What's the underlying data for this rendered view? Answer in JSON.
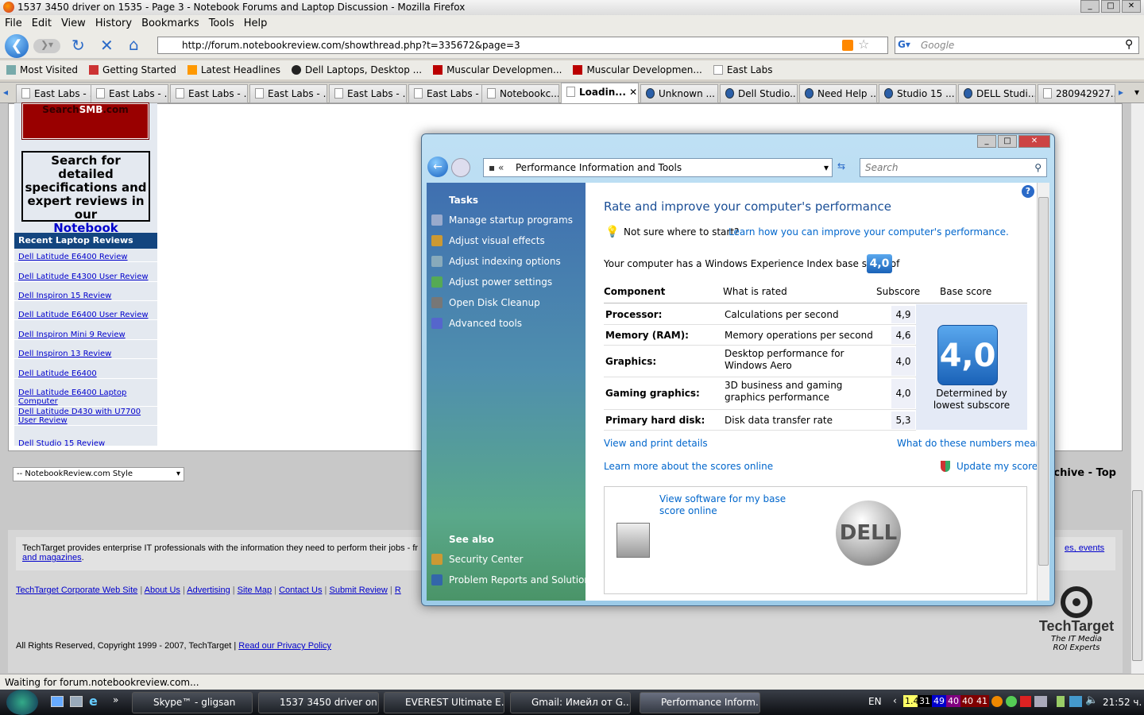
{
  "window": {
    "title": "1537 3450 driver on 1535 - Page 3 - Notebook Forums and Laptop Discussion - Mozilla Firefox"
  },
  "menu": [
    "File",
    "Edit",
    "View",
    "History",
    "Bookmarks",
    "Tools",
    "Help"
  ],
  "nav": {
    "url": "http://forum.notebookreview.com/showthread.php?t=335672&page=3",
    "search_placeholder": "Google"
  },
  "bookmarks": [
    "Most Visited",
    "Getting Started",
    "Latest Headlines",
    "Dell Laptops, Desktop ...",
    "Muscular Developmen...",
    "Muscular Developmen...",
    "East Labs"
  ],
  "tabs": [
    "East Labs - ...",
    "East Labs - ...",
    "East Labs - ...",
    "East Labs - ...",
    "East Labs - ...",
    "East Labs - ...",
    "Notebookc...",
    "Loadin...",
    "Unknown ...",
    "Dell Studio...",
    "Need Help ...",
    "Studio 15 ...",
    "DELL Studi...",
    "280942927..."
  ],
  "page": {
    "smb_a": "Search",
    "smb_b": "SMB",
    ".smb_c": ".com",
    "smb_c": ".com",
    "db_text": "Search for detailed specifications and expert reviews in our",
    "db_link": "Notebook Database",
    "reviews_heading": "Recent Laptop Reviews",
    "reviews": [
      "Dell Latitude E6400 Review",
      "Dell Latitude E4300 User Review",
      "Dell Inspiron 15 Review",
      "Dell Latitude E6400 User Review",
      "Dell Inspiron Mini 9 Review",
      "Dell Inspiron 13 Review",
      "Dell Latitude E6400",
      "Dell Latitude E6400 Laptop Computer",
      "Dell Latitude D430 with U7700 User Review",
      "Dell Studio 15 Review"
    ],
    "style_select": "-- NotebookReview.com Style",
    "archive_top": "rchive - Top",
    "footer_text": "TechTarget provides enterprise IT professionals with the information they need to perform their jobs - fr",
    "footer_link1": "and magazines",
    "footer_link2": "es, events",
    "footer_links": [
      "TechTarget Corporate Web Site",
      "About Us",
      "Advertising",
      "Site Map",
      "Contact Us",
      "Submit Review",
      "R"
    ],
    "copyright": "All Rights Reserved, Copyright 1999 - 2007, TechTarget |",
    "privacy": "Read our Privacy Policy",
    "tt_name": "TechTarget",
    "tt_tag1": "The IT Media",
    "tt_tag2": "ROI Experts"
  },
  "status": "Waiting for forum.notebookreview.com...",
  "perf": {
    "address": "Performance Information and Tools",
    "search_placeholder": "Search",
    "tasks_heading": "Tasks",
    "tasks": [
      "Manage startup programs",
      "Adjust visual effects",
      "Adjust indexing options",
      "Adjust power settings",
      "Open Disk Cleanup",
      "Advanced tools"
    ],
    "see_also": "See also",
    "see_also_items": [
      "Security Center",
      "Problem Reports and Solutions"
    ],
    "title": "Rate and improve your computer's performance",
    "hint": "Not sure where to start?",
    "hint_link": "Learn how you can improve your computer's performance.",
    "base_text": "Your computer has a Windows Experience Index base score of",
    "base_score": "4,0",
    "headers": [
      "Component",
      "What is rated",
      "Subscore",
      "Base score"
    ],
    "rows": [
      {
        "component": "Processor:",
        "rated": "Calculations per second",
        "score": "4,9"
      },
      {
        "component": "Memory (RAM):",
        "rated": "Memory operations per second",
        "score": "4,6"
      },
      {
        "component": "Graphics:",
        "rated": "Desktop performance for Windows Aero",
        "score": "4,0"
      },
      {
        "component": "Gaming graphics:",
        "rated": "3D business and gaming graphics performance",
        "score": "4,0"
      },
      {
        "component": "Primary hard disk:",
        "rated": "Disk data transfer rate",
        "score": "5,3"
      }
    ],
    "determined": "Determined by lowest subscore",
    "view_print": "View and print details",
    "what_mean": "What do these numbers mean?",
    "learn_more": "Learn more about the scores online",
    "update": "Update my score",
    "view_software": "View software for my base score online",
    "dell": "DELL"
  },
  "taskbar": {
    "tasks": [
      "Skype™ - gligsan",
      "1537 3450 driver on ...",
      "EVEREST Ultimate E...",
      "Gmail: Имейл от G...",
      "Performance Inform..."
    ],
    "lang": "EN",
    "tray": [
      "1.4",
      "31",
      "49",
      "40",
      "40",
      "41"
    ],
    "tray_colors": [
      "#ffff66",
      "#000000",
      "#0000cc",
      "#800080",
      "#800000",
      "#800000"
    ],
    "clock": "21:52 ч."
  }
}
